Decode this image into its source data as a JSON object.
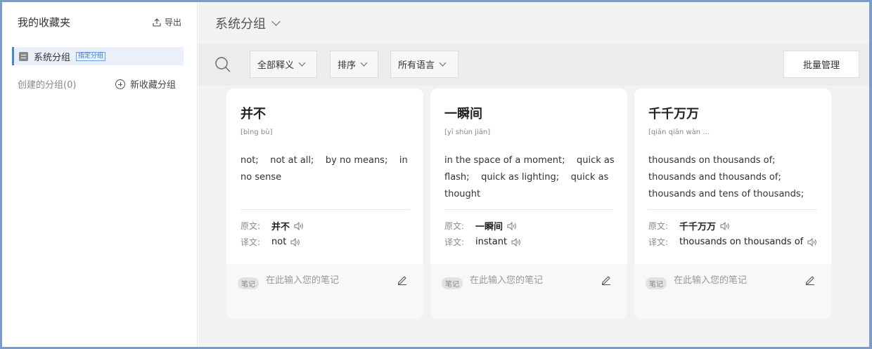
{
  "sidebar": {
    "title": "我的收藏夹",
    "export_label": "导出",
    "active_group": {
      "label": "系统分组",
      "tag": "指定分组"
    },
    "created_groups": "创建的分组(0)",
    "new_group_label": "新收藏分组"
  },
  "main": {
    "group_title": "系统分组",
    "toolbar": {
      "filter_meaning": "全部释义",
      "sort": "排序",
      "language": "所有语言",
      "batch_manage": "批量管理"
    }
  },
  "labels": {
    "original": "原文:",
    "translation": "译文:",
    "note_badge": "笔记",
    "note_placeholder": "在此输入您的笔记"
  },
  "cards": [
    {
      "word": "并不",
      "pinyin": "[bìng bù]",
      "definitions": "not;    not at all;    by no means;    in no sense",
      "original": "并不",
      "translation": "not"
    },
    {
      "word": "一瞬间",
      "pinyin": "[yī shùn jiān]",
      "definitions": "in the space of a moment;    quick as flash;    quick as lighting;    quick as thought",
      "original": "一瞬间",
      "translation": "instant"
    },
    {
      "word": "千千万万",
      "pinyin": "[qiān qiān wàn …",
      "definitions": "thousands on thousands of; thousands and thousands of; thousands and tens of thousands;",
      "original": "千千万万",
      "translation": "thousands on thousands of"
    }
  ],
  "colors": {
    "accent": "#4a86e0",
    "frame": "#7a9cc9",
    "main_bg": "#f2f2f2"
  }
}
